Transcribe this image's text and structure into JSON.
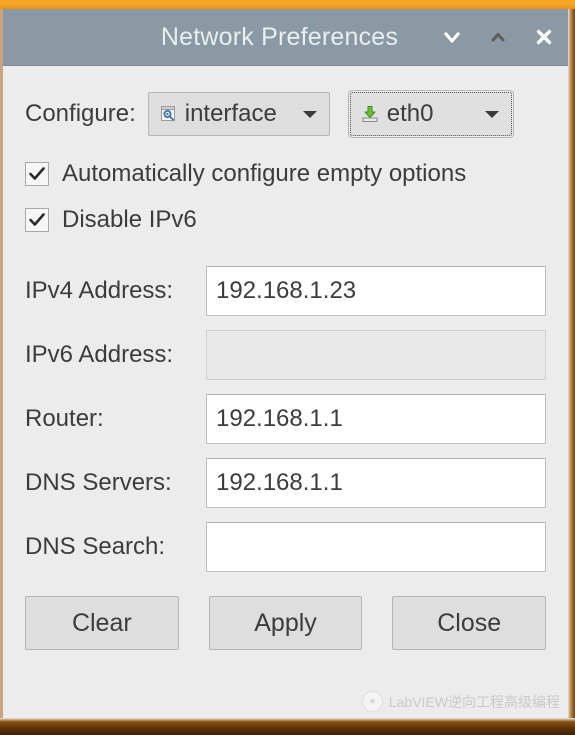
{
  "window": {
    "title": "Network Preferences",
    "titlebar_color": "#8a99a4",
    "body_color": "#ececec",
    "accent_top_color": "#f5a120",
    "frame_bottom_color": "#5c3209"
  },
  "titlebar_buttons": [
    {
      "name": "chevron-down-icon",
      "label": "Minimize",
      "state": "enabled",
      "color": "#ffffff"
    },
    {
      "name": "chevron-up-icon",
      "label": "Restore",
      "state": "disabled",
      "color": "#5d5d5d"
    },
    {
      "name": "close-icon",
      "label": "Close",
      "state": "enabled",
      "color": "#ffffff"
    }
  ],
  "configure": {
    "label": "Configure:",
    "mode_select": {
      "value": "interface",
      "icon": "interface-properties-icon",
      "arrow_icon": "chevron-down-icon",
      "focused": false
    },
    "device_select": {
      "value": "eth0",
      "icon": "network-install-icon",
      "arrow_icon": "chevron-down-icon",
      "focused": true
    }
  },
  "checkboxes": [
    {
      "label": "Automatically configure empty options",
      "checked": true,
      "name": "auto-configure-empty-options"
    },
    {
      "label": "Disable IPv6",
      "checked": true,
      "name": "disable-ipv6"
    }
  ],
  "fields": [
    {
      "label": "IPv4 Address:",
      "value": "192.168.1.23",
      "placeholder": "",
      "disabled": false,
      "name": "ipv4-address"
    },
    {
      "label": "IPv6 Address:",
      "value": "",
      "placeholder": "",
      "disabled": true,
      "name": "ipv6-address"
    },
    {
      "label": "Router:",
      "value": "192.168.1.1",
      "placeholder": "",
      "disabled": false,
      "name": "router"
    },
    {
      "label": "DNS Servers:",
      "value": "192.168.1.1",
      "placeholder": "",
      "disabled": false,
      "name": "dns-servers"
    },
    {
      "label": "DNS Search:",
      "value": "",
      "placeholder": "",
      "disabled": false,
      "name": "dns-search"
    }
  ],
  "buttons": [
    {
      "label": "Clear",
      "name": "clear-button"
    },
    {
      "label": "Apply",
      "name": "apply-button"
    },
    {
      "label": "Close",
      "name": "close-button"
    }
  ],
  "watermark": {
    "text": "LabVIEW逆向工程高级编程",
    "logo": "circular-logo-icon"
  }
}
